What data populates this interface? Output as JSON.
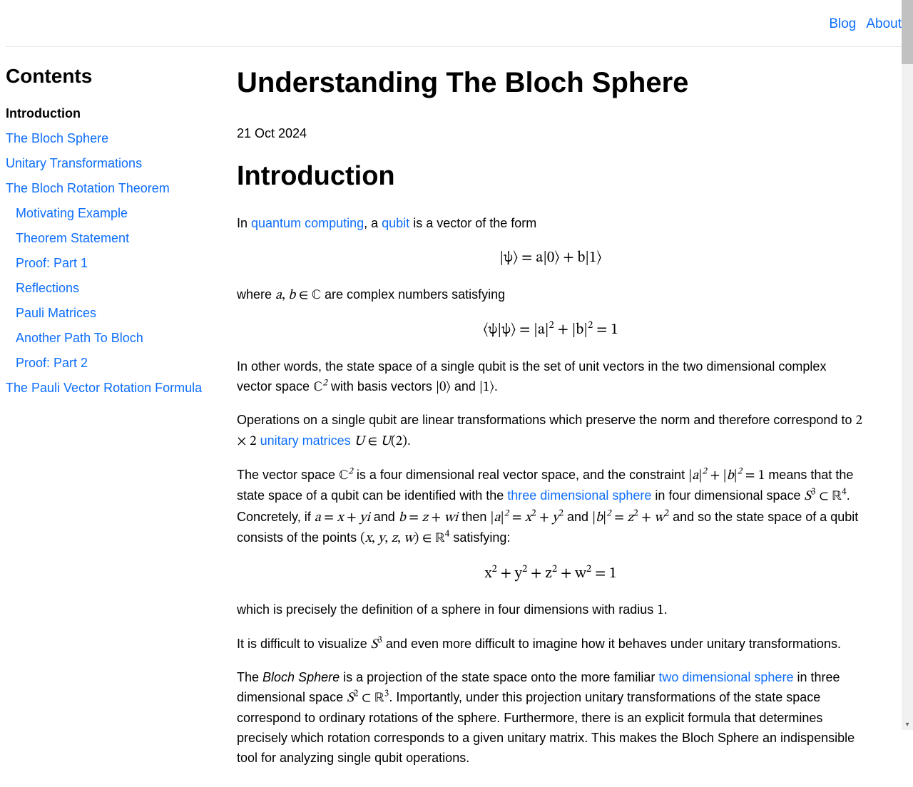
{
  "nav": {
    "blog": "Blog",
    "about": "About"
  },
  "sidebar": {
    "heading": "Contents",
    "items": [
      {
        "label": "Introduction",
        "current": true
      },
      {
        "label": "The Bloch Sphere"
      },
      {
        "label": "Unitary Transformations"
      },
      {
        "label": "The Bloch Rotation Theorem",
        "children": [
          {
            "label": "Motivating Example"
          },
          {
            "label": "Theorem Statement"
          },
          {
            "label": "Proof: Part 1"
          },
          {
            "label": "Reflections"
          },
          {
            "label": "Pauli Matrices"
          },
          {
            "label": "Another Path To Bloch"
          },
          {
            "label": "Proof: Part 2"
          }
        ]
      },
      {
        "label": "The Pauli Vector Rotation Formula"
      }
    ]
  },
  "article": {
    "title": "Understanding The Bloch Sphere",
    "date": "21 Oct 2024",
    "section_heading": "Introduction",
    "p1_a": "In ",
    "p1_link1": "quantum computing",
    "p1_b": ", a ",
    "p1_link2": "qubit",
    "p1_c": " is a vector of the form",
    "eq1": "|ψ⟩ = a|0⟩ + b|1⟩",
    "p2_a": "where ",
    "p2_math": "a, b ∈ ℂ",
    "p2_b": " are complex numbers satisfying",
    "eq2": "⟨ψ|ψ⟩ = |a|² + |b|² = 1",
    "p3_a": "In other words, the state space of a single qubit is the set of unit vectors in the two dimensional complex vector space ",
    "p3_m1": "ℂ²",
    "p3_b": " with basis vectors ",
    "p3_m2": "|0⟩",
    "p3_c": " and ",
    "p3_m3": "|1⟩",
    "p3_d": ".",
    "p4_a": "Operations on a single qubit are linear transformations which preserve the norm and therefore correspond to ",
    "p4_m1": "2 × 2",
    "p4_b": " ",
    "p4_link": "unitary matrices",
    "p4_c": " ",
    "p4_m2": "U ∈ U(2)",
    "p4_d": ".",
    "p5_a": "The vector space ",
    "p5_m1": "ℂ²",
    "p5_b": " is a four dimensional real vector space, and the constraint ",
    "p5_m2": "|a|² + |b|² = 1",
    "p5_c": " means that the state space of a qubit can be identified with the ",
    "p5_link": "three dimensional sphere",
    "p5_d": " in four dimensional space ",
    "p5_m3": "S³ ⊂ ℝ⁴",
    "p5_e": ". Concretely, if ",
    "p5_m4": "a = x + yi",
    "p5_f": " and ",
    "p5_m5": "b = z + wi",
    "p5_g": " then ",
    "p5_m6": "|a|² = x² + y²",
    "p5_h": " and ",
    "p5_m7": "|b|² = z² + w²",
    "p5_i": " and so the state space of a qubit consists of the points ",
    "p5_m8": "(x, y, z, w) ∈ ℝ⁴",
    "p5_j": " satisfying:",
    "eq3": "x² + y² + z² + w² = 1",
    "p6_a": "which is precisely the definition of a sphere in four dimensions with radius ",
    "p6_m1": "1",
    "p6_b": ".",
    "p7_a": "It is difficult to visualize ",
    "p7_m1": "S³",
    "p7_b": " and even more difficult to imagine how it behaves under unitary transformations.",
    "p8_a": "The ",
    "p8_em": "Bloch Sphere",
    "p8_b": " is a projection of the state space onto the more familiar ",
    "p8_link": "two dimensional sphere",
    "p8_c": " in three dimensional space ",
    "p8_m1": "S² ⊂ ℝ³",
    "p8_d": ". Importantly, under this projection unitary transformations of the state space correspond to ordinary rotations of the sphere. Furthermore, there is an explicit formula that determines precisely which rotation corresponds to a given unitary matrix. This makes the Bloch Sphere an indispensible tool for analyzing single qubit operations."
  }
}
